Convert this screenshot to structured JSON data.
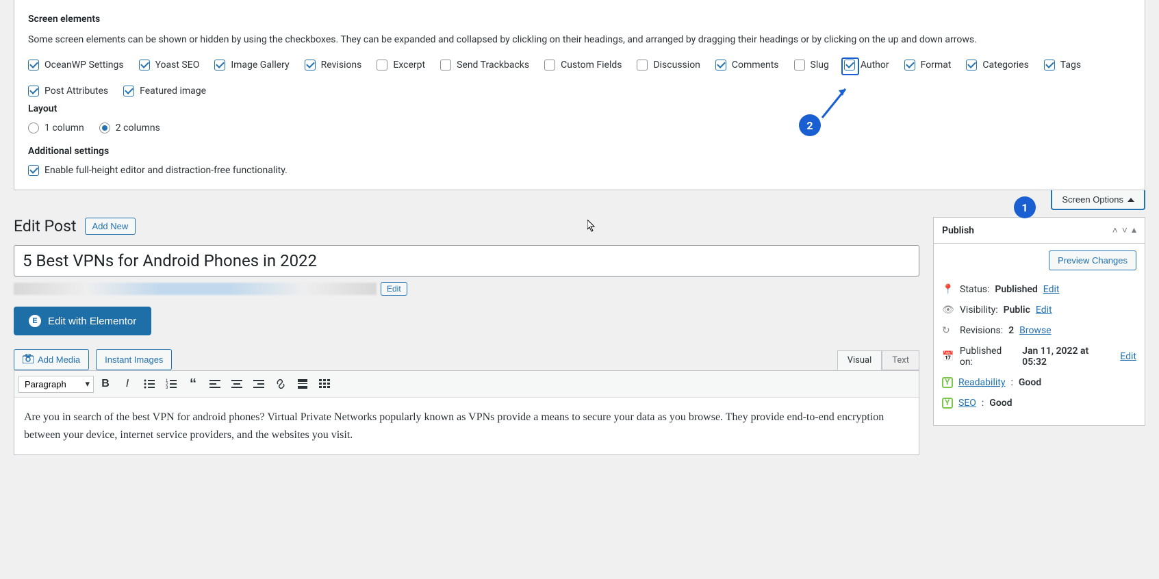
{
  "screen_options": {
    "heading_elements": "Screen elements",
    "description": "Some screen elements can be shown or hidden by using the checkboxes. They can be expanded and collapsed by clickling on their headings, and arranged by dragging their headings or by clicking on the up and down arrows.",
    "checkboxes": [
      {
        "label": "OceanWP Settings",
        "checked": true
      },
      {
        "label": "Yoast SEO",
        "checked": true
      },
      {
        "label": "Image Gallery",
        "checked": true
      },
      {
        "label": "Revisions",
        "checked": true
      },
      {
        "label": "Excerpt",
        "checked": false
      },
      {
        "label": "Send Trackbacks",
        "checked": false
      },
      {
        "label": "Custom Fields",
        "checked": false
      },
      {
        "label": "Discussion",
        "checked": false
      },
      {
        "label": "Comments",
        "checked": true
      },
      {
        "label": "Slug",
        "checked": false
      },
      {
        "label": "Author",
        "checked": true,
        "highlight": true
      },
      {
        "label": "Format",
        "checked": true
      },
      {
        "label": "Categories",
        "checked": true
      },
      {
        "label": "Tags",
        "checked": true
      },
      {
        "label": "Post Attributes",
        "checked": true
      },
      {
        "label": "Featured image",
        "checked": true
      }
    ],
    "heading_layout": "Layout",
    "layout_options": [
      {
        "label": "1 column",
        "checked": false
      },
      {
        "label": "2 columns",
        "checked": true
      }
    ],
    "heading_additional": "Additional settings",
    "additional_label": "Enable full-height editor and distraction-free functionality.",
    "tab_label": "Screen Options"
  },
  "annotations": {
    "one": "1",
    "two": "2"
  },
  "edit_post": {
    "heading": "Edit Post",
    "add_new": "Add New",
    "title": "5 Best VPNs for Android Phones in 2022",
    "edit_link": "Edit",
    "elementor_btn": "Edit with Elementor",
    "add_media": "Add Media",
    "instant_images": "Instant Images",
    "tab_visual": "Visual",
    "tab_text": "Text",
    "format_selector": "Paragraph",
    "content": "Are you in search of the best VPN for android phones? Virtual Private Networks popularly known as VPNs provide a means to secure your data as you browse. They provide end-to-end encryption between your device, internet service providers, and the websites you visit."
  },
  "publish": {
    "heading": "Publish",
    "preview": "Preview Changes",
    "status_label": "Status:",
    "status_value": "Published",
    "status_edit": "Edit",
    "visibility_label": "Visibility:",
    "visibility_value": "Public",
    "visibility_edit": "Edit",
    "revisions_label": "Revisions:",
    "revisions_value": "2",
    "revisions_browse": "Browse",
    "published_label": "Published on:",
    "published_value": "Jan 11, 2022 at 05:32",
    "published_edit": "Edit",
    "readability_label": "Readability",
    "readability_value": "Good",
    "seo_label": "SEO",
    "seo_value": "Good"
  }
}
